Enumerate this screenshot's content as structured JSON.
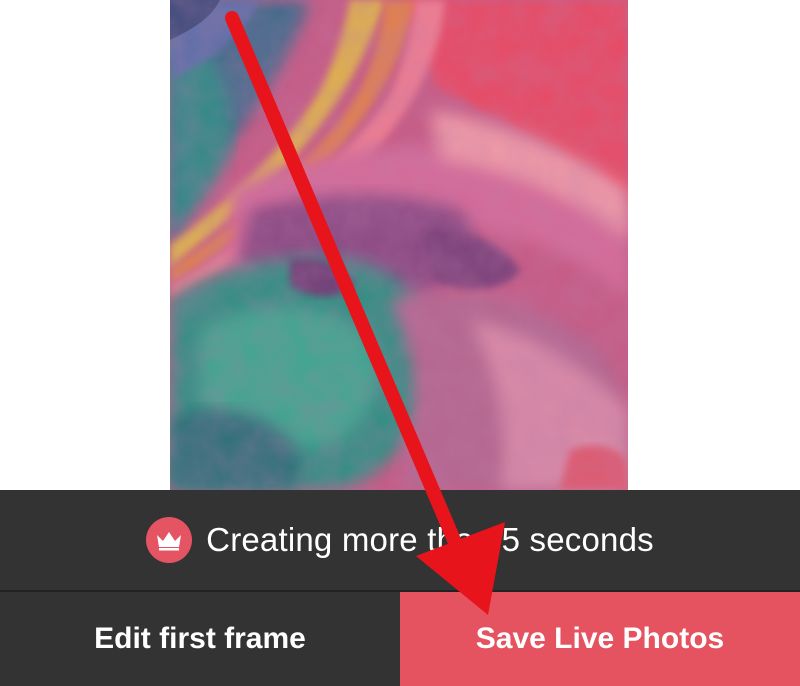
{
  "preview": {
    "icon": "abstract-wallpaper-image"
  },
  "banner": {
    "icon": "crown-icon",
    "text": "Creating more than 5 seconds"
  },
  "buttons": {
    "edit_label": "Edit first frame",
    "save_label": "Save Live Photos"
  },
  "annotation": {
    "icon": "red-arrow-annotation"
  },
  "colors": {
    "accent": "#e4535f",
    "dark_bar": "#333333",
    "arrow": "#e8141c"
  }
}
